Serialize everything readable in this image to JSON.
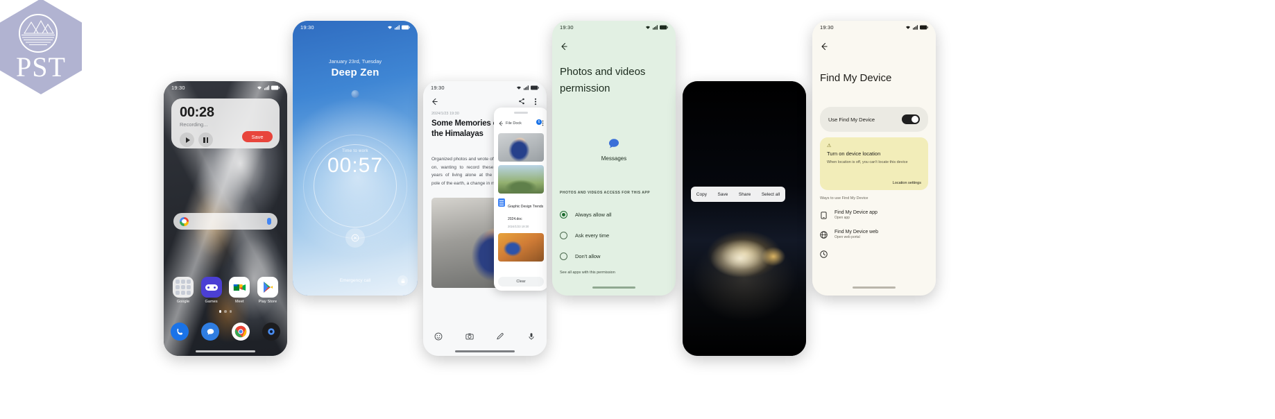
{
  "logo": {
    "text": "PST",
    "color": "#aaadcd"
  },
  "phone1": {
    "name": "recorder-home-screen",
    "status_time": "19:30",
    "recorder": {
      "time": "00:28",
      "status": "Recording...",
      "play_icon": "play-icon",
      "pause_icon": "pause-icon",
      "save_label": "Save"
    },
    "search_placeholder": "",
    "apps": [
      {
        "label": "Google",
        "icon": "google-folder-icon"
      },
      {
        "label": "Games",
        "icon": "games-icon"
      },
      {
        "label": "Meet",
        "icon": "meet-icon"
      },
      {
        "label": "Play Store",
        "icon": "play-store-icon"
      }
    ],
    "dock": [
      {
        "icon": "phone-icon"
      },
      {
        "icon": "messages-icon"
      },
      {
        "icon": "chrome-icon"
      },
      {
        "icon": "camera-icon"
      }
    ]
  },
  "phone2": {
    "name": "deep-zen-lock-screen",
    "status_time": "19:30",
    "date": "January 23rd, Tuesday",
    "title": "Deep Zen",
    "timer_label": "Time to work",
    "timer": "00:57",
    "emergency_call": "Emergency call",
    "lock_icon": "lock-icon",
    "camera_icon": "camera-icon"
  },
  "phone3": {
    "name": "memories-note-screen",
    "status_time": "19:30",
    "back_icon": "back-arrow-icon",
    "share_icon": "share-icon",
    "more_icon": "more-vertical-icon",
    "date": "2024/1/23  19:30",
    "title": "Some Memories of the Himalayas",
    "body": "Organized photos and wrote off and on, wanting to record these two years of living alone at the third pole of the earth, a change in me.",
    "file_dock": {
      "back_icon": "back-arrow-icon",
      "title": "File Dock",
      "more_icon": "more-vertical-icon",
      "badge": "6",
      "items": [
        {
          "type": "image",
          "name": "photo-thumb-1"
        },
        {
          "type": "image",
          "name": "photo-thumb-2"
        },
        {
          "type": "doc",
          "title": "Graphic Design Trends 2024.doc",
          "date": "2024/1/23  19:30"
        },
        {
          "type": "image",
          "name": "photo-thumb-3"
        }
      ],
      "clear_label": "Clear"
    },
    "bottom_bar": [
      {
        "icon": "sticker-icon"
      },
      {
        "icon": "camera-icon"
      },
      {
        "icon": "pen-icon"
      },
      {
        "icon": "mic-icon"
      }
    ]
  },
  "phone4": {
    "name": "photos-videos-permission-screen",
    "status_time": "19:30",
    "back_icon": "back-arrow-icon",
    "title": "Photos and videos permission",
    "app_icon": "messages-icon",
    "app_name": "Messages",
    "section_label": "PHOTOS AND VIDEOS ACCESS FOR THIS APP",
    "options": [
      {
        "label": "Always allow all",
        "selected": true
      },
      {
        "label": "Ask every time",
        "selected": false
      },
      {
        "label": "Don't allow",
        "selected": false
      }
    ],
    "footer_link": "See all apps with this permission"
  },
  "phone5": {
    "name": "photo-selection-screen",
    "toolbar": [
      "Copy",
      "Save",
      "Share",
      "Select all"
    ]
  },
  "phone6": {
    "name": "find-my-device-screen",
    "status_time": "19:30",
    "back_icon": "back-arrow-icon",
    "title": "Find My Device",
    "toggle_label": "Use Find My Device",
    "toggle_on": true,
    "warning": {
      "icon": "warning-icon",
      "title": "Turn on device location",
      "body": "When location is off, you can't locate this device",
      "link": "Location settings"
    },
    "section_label": "Ways to use Find My Device",
    "rows": [
      {
        "icon": "phone-icon",
        "title": "Find My Device app",
        "subtitle": "Open app"
      },
      {
        "icon": "globe-icon",
        "title": "Find My Device web",
        "subtitle": "Open web portal"
      },
      {
        "icon": "clock-icon",
        "title": "",
        "subtitle": ""
      }
    ]
  }
}
